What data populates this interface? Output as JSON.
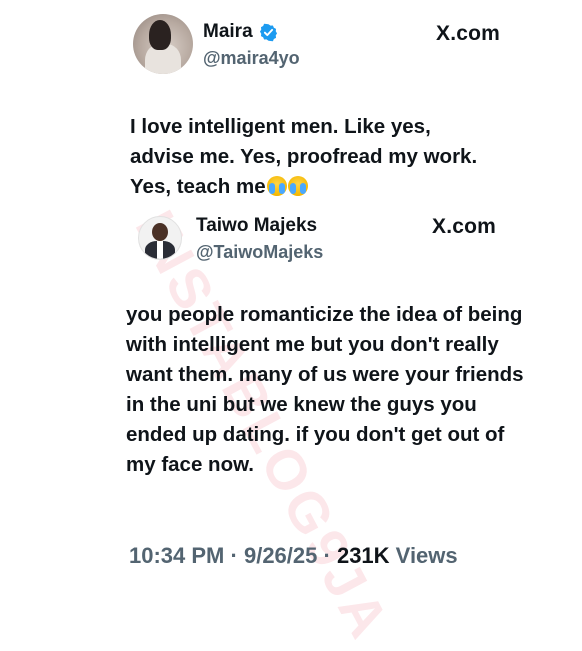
{
  "tweet": {
    "author": {
      "display_name": "Maira",
      "handle": "@maira4yo",
      "verified": true,
      "verified_color": "#1d9bf0"
    },
    "site_label": "X.com",
    "text": "I love intelligent men. Like yes, advise me. Yes, proofread my work. Yes, teach me",
    "emoji": [
      "loudly-crying-face-emoji",
      "loudly-crying-face-emoji"
    ]
  },
  "quoted_tweet": {
    "author": {
      "display_name": "Taiwo Majeks",
      "handle": "@TaiwoMajeks"
    },
    "site_label": "X.com",
    "text": "you people romanticize the idea of being with intelligent me but you don't really want them. many of us were your friends in the uni but we knew the guys you ended up dating. if you don't get out of my face now."
  },
  "meta": {
    "time": "10:34 PM",
    "separator": "·",
    "date": "9/26/25",
    "views_count": "231K",
    "views_label": "Views"
  },
  "watermark": {
    "text": "INSTABLOG9JA"
  },
  "colors": {
    "text_primary": "#0f1419",
    "text_secondary": "#536471",
    "background": "#ffffff",
    "watermark": "#f0788c"
  }
}
